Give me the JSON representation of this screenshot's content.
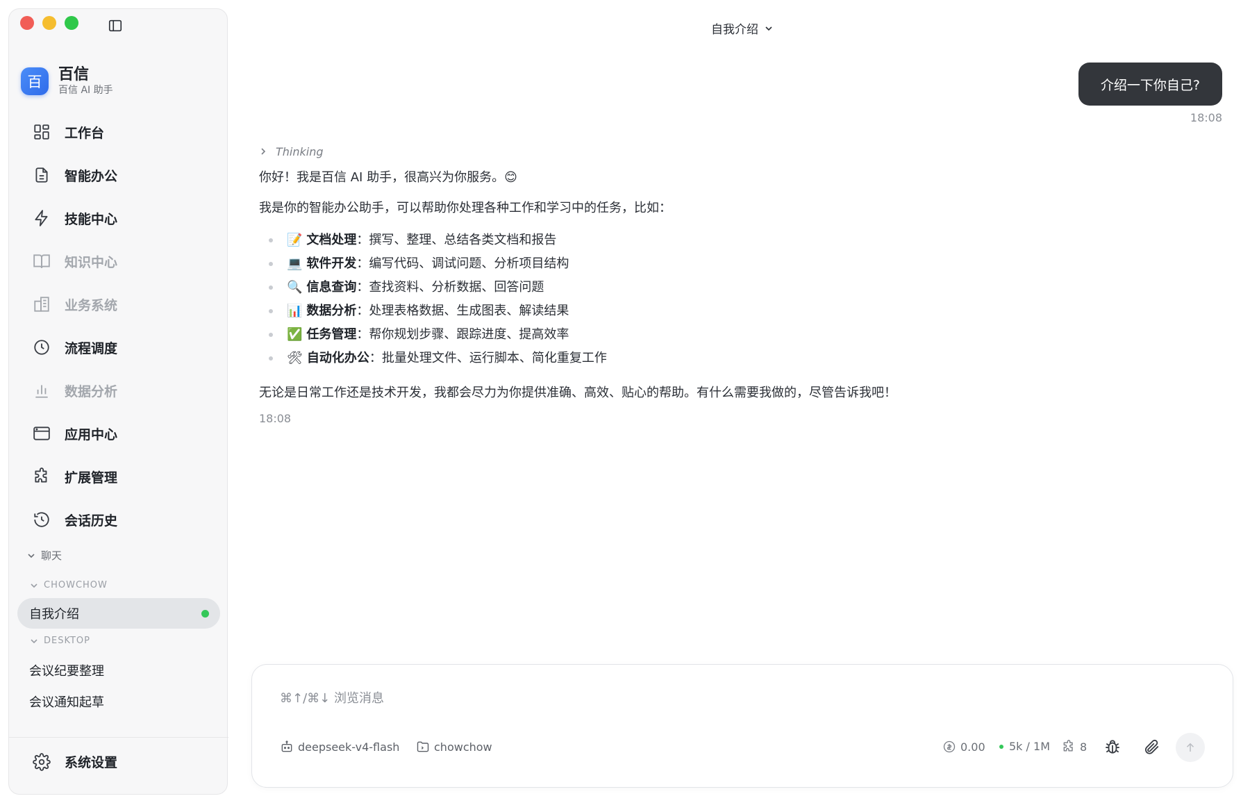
{
  "app": {
    "name": "百信",
    "subtitle": "百信 AI 助手",
    "logo_char": "百",
    "accent": "#2f6bea"
  },
  "nav": {
    "items": [
      {
        "label": "工作台",
        "icon": "dashboard-icon",
        "muted": false
      },
      {
        "label": "智能办公",
        "icon": "document-icon",
        "muted": false
      },
      {
        "label": "技能中心",
        "icon": "lightning-icon",
        "muted": false
      },
      {
        "label": "知识中心",
        "icon": "book-icon",
        "muted": true
      },
      {
        "label": "业务系统",
        "icon": "building-icon",
        "muted": true
      },
      {
        "label": "流程调度",
        "icon": "clock-icon",
        "muted": false
      },
      {
        "label": "数据分析",
        "icon": "bar-chart-icon",
        "muted": true
      },
      {
        "label": "应用中心",
        "icon": "browser-window-icon",
        "muted": false
      },
      {
        "label": "扩展管理",
        "icon": "puzzle-icon",
        "muted": false
      },
      {
        "label": "会话历史",
        "icon": "history-icon",
        "muted": false
      }
    ]
  },
  "chats": {
    "section_label": "聊天",
    "groups": [
      {
        "name": "CHOWCHOW",
        "items": [
          {
            "label": "自我介绍",
            "active": true
          }
        ]
      },
      {
        "name": "DESKTOP",
        "items": [
          {
            "label": "会议纪要整理",
            "active": false
          },
          {
            "label": "会议通知起草",
            "active": false
          }
        ]
      }
    ]
  },
  "settings_label": "系统设置",
  "header": {
    "title": "自我介绍"
  },
  "conversation": {
    "user_message": "介绍一下你自己?",
    "user_time": "18:08",
    "thinking_label": "Thinking",
    "greeting": "你好！我是百信 AI 助手，很高兴为你服务。😊",
    "intro": "我是你的智能办公助手，可以帮助你处理各种工作和学习中的任务，比如：",
    "capabilities": [
      {
        "emoji": "📝",
        "title": "文档处理",
        "desc": "：撰写、整理、总结各类文档和报告"
      },
      {
        "emoji": "💻",
        "title": "软件开发",
        "desc": "：编写代码、调试问题、分析项目结构"
      },
      {
        "emoji": "🔍",
        "title": "信息查询",
        "desc": "：查找资料、分析数据、回答问题"
      },
      {
        "emoji": "📊",
        "title": "数据分析",
        "desc": "：处理表格数据、生成图表、解读结果"
      },
      {
        "emoji": "✅",
        "title": "任务管理",
        "desc": "：帮你规划步骤、跟踪进度、提高效率"
      },
      {
        "emoji": "🛠",
        "title": "自动化办公",
        "desc": "：批量处理文件、运行脚本、简化重复工作"
      }
    ],
    "closing": "无论是日常工作还是技术开发，我都会尽力为你提供准确、高效、贴心的帮助。有什么需要我做的，尽管告诉我吧！",
    "assistant_time": "18:08"
  },
  "composer": {
    "placeholder": "⌘↑/⌘↓ 浏览消息",
    "model": "deepseek-v4-flash",
    "folder": "chowchow",
    "cost": "0.00",
    "context": "5k / 1M",
    "extensions_count": "8"
  }
}
